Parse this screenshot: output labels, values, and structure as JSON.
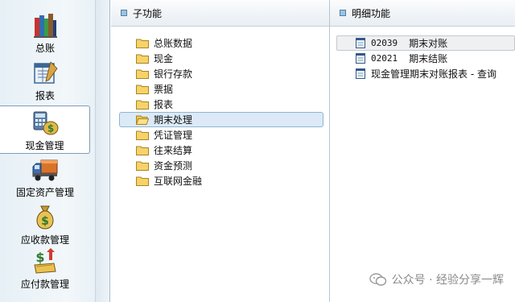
{
  "nav": {
    "items": [
      {
        "label": "总账",
        "icon": "books-icon"
      },
      {
        "label": "报表",
        "icon": "report-icon"
      },
      {
        "label": "现金管理",
        "icon": "cash-calculator-icon"
      },
      {
        "label": "固定资产管理",
        "icon": "truck-icon"
      },
      {
        "label": "应收款管理",
        "icon": "money-bag-icon"
      },
      {
        "label": "应付款管理",
        "icon": "dollar-payment-icon"
      }
    ],
    "selected": "现金管理"
  },
  "subfunctions": {
    "title": "子功能",
    "items": [
      "总账数据",
      "现金",
      "银行存款",
      "票据",
      "报表",
      "期末处理",
      "凭证管理",
      "往来结算",
      "资金预测",
      "互联网金融"
    ],
    "selected": "期末处理"
  },
  "details": {
    "title": "明细功能",
    "items": [
      {
        "code": "02039",
        "name": "期末对账"
      },
      {
        "code": "02021",
        "name": "期末结账"
      },
      {
        "code": "",
        "name": "现金管理期末对账报表 - 查询"
      }
    ],
    "hovered": "期末对账"
  },
  "watermark": {
    "text": "公众号 · 经验分享一辉"
  },
  "colors": {
    "nav_bg": "#e6f0f6",
    "selection_bg": "#dbeaf6",
    "selection_border": "#8fb4d4",
    "folder_yellow": "#f6d36a"
  }
}
